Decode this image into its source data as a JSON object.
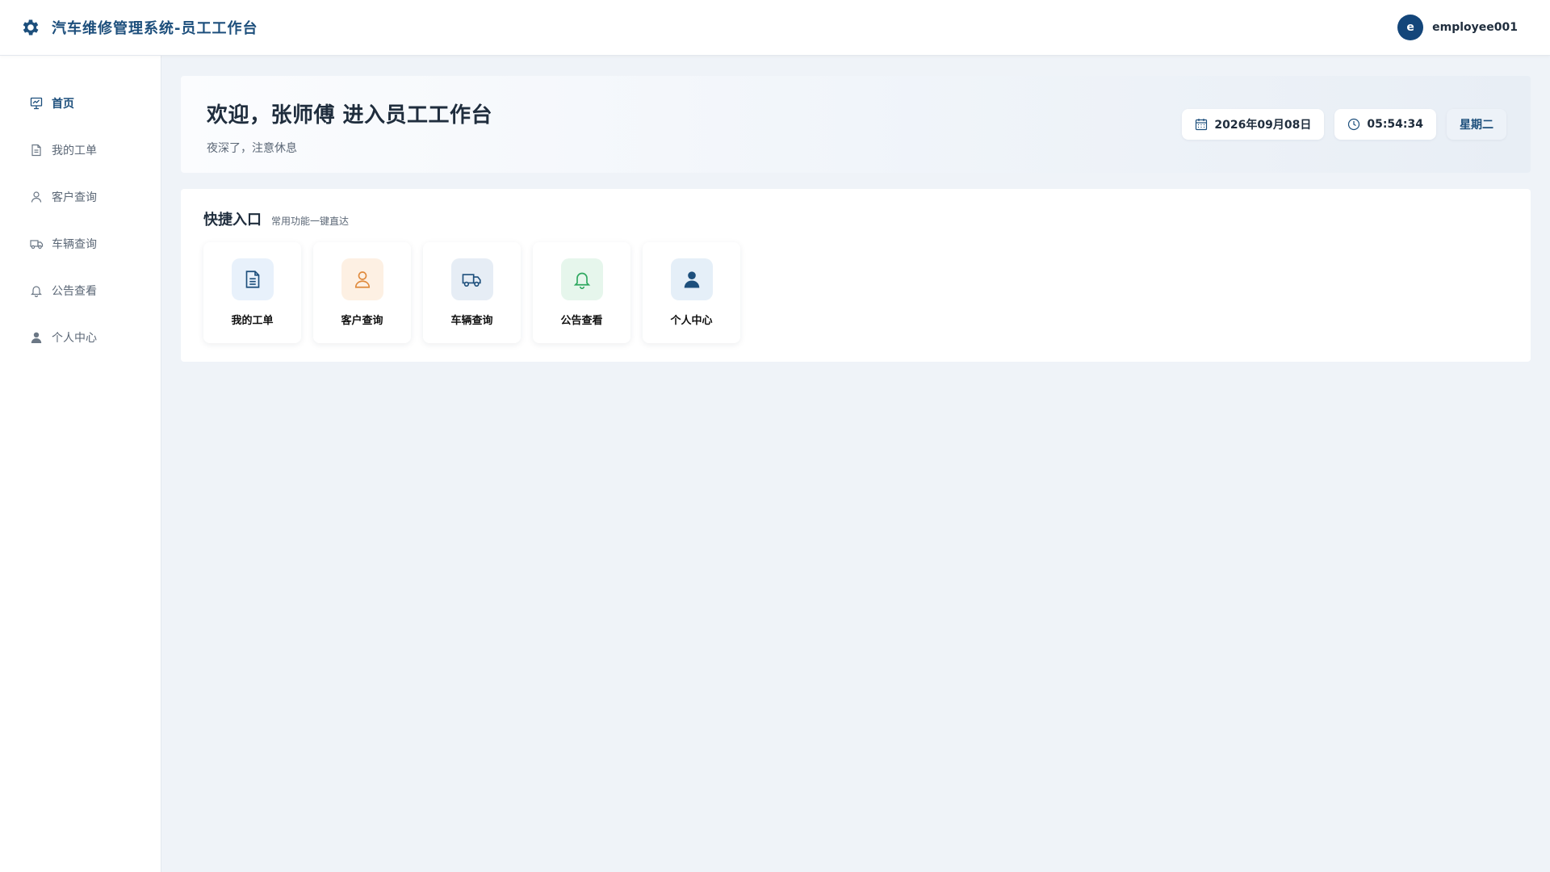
{
  "header": {
    "title": "汽车维修管理系统-员工工作台",
    "avatar_letter": "e",
    "username": "employee001"
  },
  "sidebar": {
    "items": [
      {
        "label": "首页",
        "icon": "dashboard-chart-icon",
        "active": true
      },
      {
        "label": "我的工单",
        "icon": "document-icon"
      },
      {
        "label": "客户查询",
        "icon": "user-icon"
      },
      {
        "label": "车辆查询",
        "icon": "truck-icon"
      },
      {
        "label": "公告查看",
        "icon": "bell-icon"
      },
      {
        "label": "个人中心",
        "icon": "user-filled-icon"
      }
    ]
  },
  "welcome": {
    "title": "欢迎，张师傅 进入员工工作台",
    "subtitle": "夜深了，注意休息",
    "date": "2026年09月08日",
    "time": "05:54:34",
    "weekday": "星期二"
  },
  "quick": {
    "title": "快捷入口",
    "subtitle": "常用功能一键直达",
    "cards": [
      {
        "label": "我的工单",
        "icon": "document-icon",
        "bg": "#e8f1fb",
        "fg": "#1d4f7c"
      },
      {
        "label": "客户查询",
        "icon": "user-icon",
        "bg": "#fdf0e3",
        "fg": "#e08a3c"
      },
      {
        "label": "车辆查询",
        "icon": "truck-icon",
        "bg": "#e6edf5",
        "fg": "#1d4f7c"
      },
      {
        "label": "公告查看",
        "icon": "bell-icon",
        "bg": "#e6f6ec",
        "fg": "#2fa860"
      },
      {
        "label": "个人中心",
        "icon": "user-filled-icon",
        "bg": "#e5eff8",
        "fg": "#1d4f7c"
      }
    ]
  },
  "colors": {
    "primary": "#1d4f7c",
    "avatar_bg": "#14467a",
    "page_bg": "#eff3f8"
  }
}
